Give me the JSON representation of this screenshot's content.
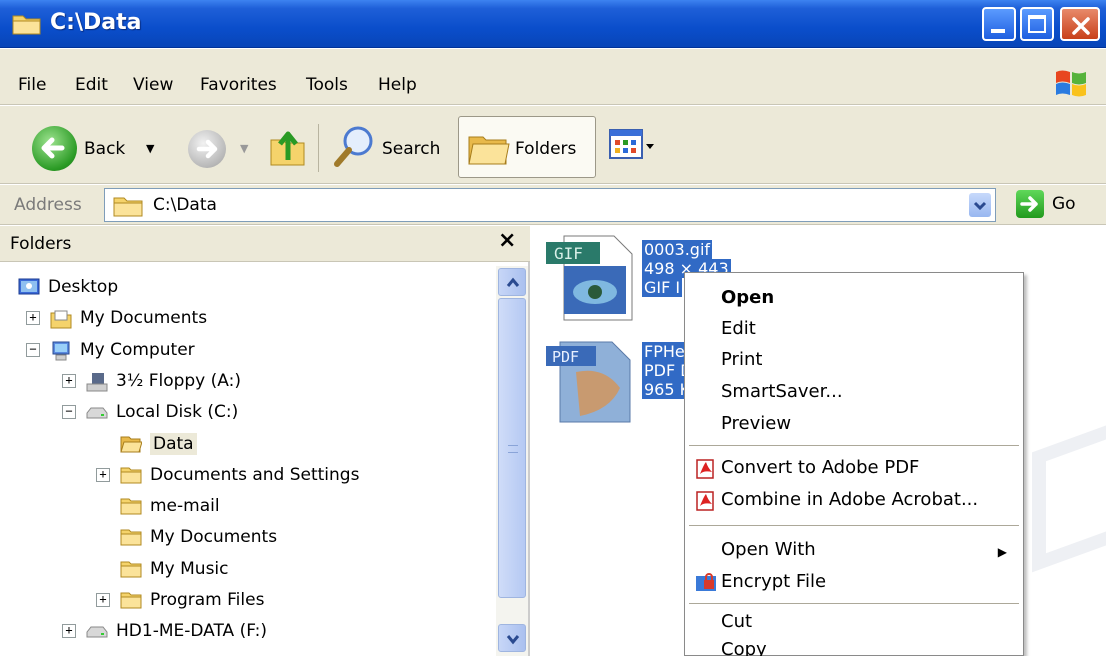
{
  "window": {
    "title": "C:\\Data"
  },
  "menu": [
    "File",
    "Edit",
    "View",
    "Favorites",
    "Tools",
    "Help"
  ],
  "toolbar": {
    "back_label": "Back",
    "search_label": "Search",
    "folders_label": "Folders"
  },
  "address": {
    "label": "Address",
    "path": "C:\\Data",
    "go_label": "Go"
  },
  "folder_pane": {
    "title": "Folders",
    "close": "×",
    "tree": [
      {
        "label": "Desktop",
        "level": 0,
        "expander": "none",
        "icon": "desktop-icon"
      },
      {
        "label": "My Documents",
        "level": 1,
        "expander": "plus",
        "icon": "my-documents-icon"
      },
      {
        "label": "My Computer",
        "level": 1,
        "expander": "minus",
        "icon": "my-computer-icon"
      },
      {
        "label": "3½ Floppy (A:)",
        "level": 2,
        "expander": "plus",
        "icon": "floppy-icon"
      },
      {
        "label": "Local Disk (C:)",
        "level": 2,
        "expander": "minus",
        "icon": "disk-icon"
      },
      {
        "label": "Data",
        "level": 3,
        "expander": "none",
        "icon": "folder-open-icon",
        "selected": true
      },
      {
        "label": "Documents and Settings",
        "level": 3,
        "expander": "plus",
        "icon": "folder-icon"
      },
      {
        "label": "me-mail",
        "level": 3,
        "expander": "none",
        "icon": "folder-icon"
      },
      {
        "label": "My Documents",
        "level": 3,
        "expander": "none",
        "icon": "folder-icon"
      },
      {
        "label": "My Music",
        "level": 3,
        "expander": "none",
        "icon": "folder-icon"
      },
      {
        "label": "Program Files",
        "level": 3,
        "expander": "plus",
        "icon": "folder-icon"
      },
      {
        "label": "HD1-ME-DATA (F:)",
        "level": 2,
        "expander": "plus",
        "icon": "disk-icon"
      }
    ]
  },
  "files": [
    {
      "icon_label": "GIF",
      "name": "0003.gif",
      "line2": "498 × 443",
      "line3": "GIF I"
    },
    {
      "icon_label": "PDF",
      "name": "FPHe",
      "line2": "PDF D",
      "line3": "965 K"
    }
  ],
  "context_menu": {
    "open": "Open",
    "edit": "Edit",
    "print": "Print",
    "smartsaver": "SmartSaver...",
    "preview": "Preview",
    "convert_pdf": "Convert to Adobe PDF",
    "combine_acrobat": "Combine in Adobe Acrobat...",
    "open_with": "Open With",
    "encrypt": "Encrypt File",
    "cut": "Cut",
    "copy": "Copy"
  },
  "colors": {
    "titlebar": "#0a4ecb",
    "chrome": "#ece9d8",
    "selection": "#316ac5"
  }
}
